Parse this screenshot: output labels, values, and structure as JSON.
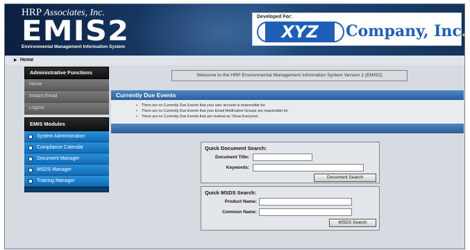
{
  "header": {
    "hrp_prefix": "HRP",
    "hrp_suffix": "Associates, Inc.",
    "app_title": "EMIS2",
    "app_subtitle": "Environmental Management Information System",
    "developed_for_label": "Developed For:",
    "client_logo_mark": "XYZ",
    "client_name": "Company, Inc",
    "client_name_dot": "."
  },
  "breadcrumb": {
    "current": "Home"
  },
  "sidebar": {
    "admin_title": "Administrative Functions",
    "admin_items": [
      {
        "label": "Home"
      },
      {
        "label": "Instant Email"
      },
      {
        "label": "Logout"
      }
    ],
    "modules_title": "EMIS Modules",
    "modules": [
      {
        "label": "System Administration"
      },
      {
        "label": "Compliance Calendar"
      },
      {
        "label": "Document Manager"
      },
      {
        "label": "MSDS Manager"
      },
      {
        "label": "Training Manager"
      }
    ]
  },
  "welcome": "Welcome to the HRP Environmental Management Information System Version 2 (EMIS2)",
  "due_events": {
    "title": "Currently Due Events",
    "lines": [
      "There are no Currently Due Events that your user account is responsible for.",
      "There are no Currently Due Events that your Email Notification Groups are responsible for.",
      "There are no Currently Due Events that are marked as 'Show Everyone'."
    ]
  },
  "doc_search": {
    "title": "Quick Document Search:",
    "doc_title_label": "Document Title:",
    "doc_title_value": "",
    "keywords_label": "Keywords:",
    "keywords_value": "",
    "button_label": "Document Search"
  },
  "msds_search": {
    "title": "Quick MSDS Search:",
    "product_label": "Product Name:",
    "product_value": "",
    "common_label": "Common Name:",
    "common_value": "",
    "button_label": "MSDS Search"
  },
  "colors": {
    "banner": "#1f4a7e",
    "client_blue": "#1f5fb5",
    "module_blue": "#1d7fcf",
    "panel_header": "#3d73b0"
  }
}
